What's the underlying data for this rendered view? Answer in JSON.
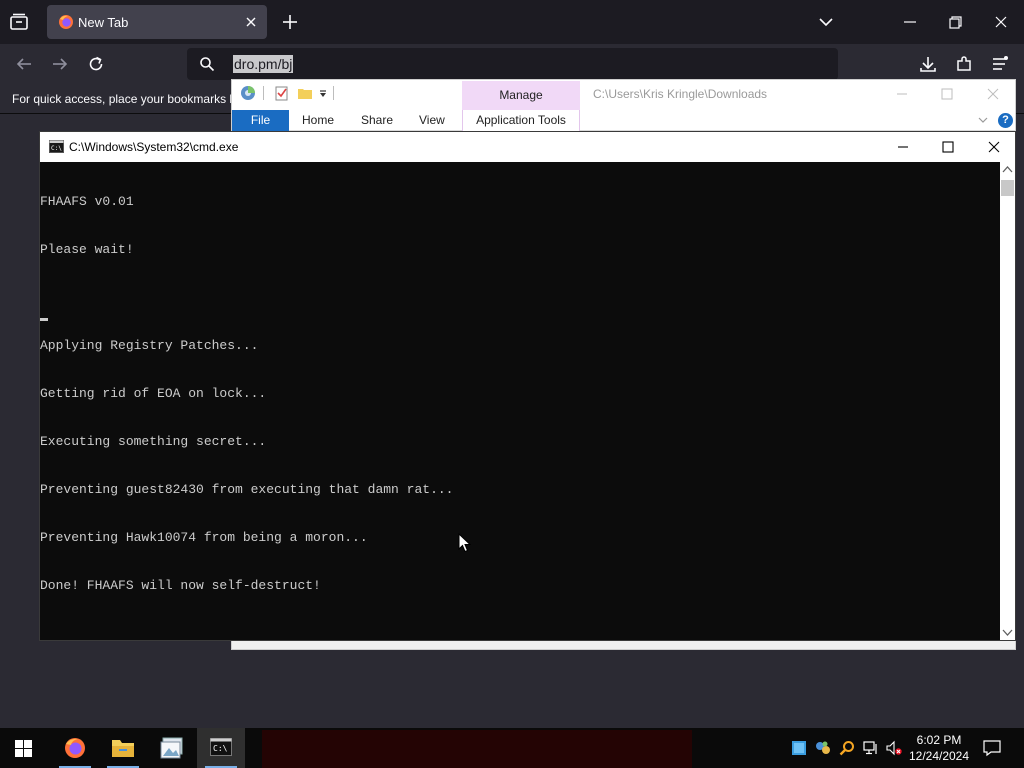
{
  "firefox": {
    "tab_title": "New Tab",
    "url_text": "dro.pm/bj",
    "bookmarks_msg": "For quick access, place your bookmarks h",
    "icons": [
      "tabs-list-icon",
      "firefox-icon",
      "close-icon",
      "plus-icon",
      "chevron-down-icon",
      "minimize-icon",
      "restore-icon",
      "close-icon",
      "back-icon",
      "forward-icon",
      "reload-icon",
      "search-icon",
      "download-icon",
      "extensions-icon",
      "hamburger-menu-icon"
    ]
  },
  "explorer": {
    "manage_label": "Manage",
    "path": "C:\\Users\\Kris Kringle\\Downloads",
    "tabs": {
      "file": "File",
      "home": "Home",
      "share": "Share",
      "view": "View",
      "app_tools": "Application Tools"
    },
    "help": "?"
  },
  "cmd": {
    "title": "C:\\Windows\\System32\\cmd.exe",
    "lines": [
      "FHAAFS v0.01",
      "Please wait!",
      "",
      "Applying Registry Patches...",
      "Getting rid of EOA on lock...",
      "Executing something secret...",
      "Preventing guest82430 from executing that damn rat...",
      "Preventing Hawk10074 from being a moron...",
      "Done! FHAAFS will now self-destruct!"
    ]
  },
  "taskbar": {
    "time": "6:02 PM",
    "date": "12/24/2024",
    "apps": [
      "start-icon",
      "firefox-icon",
      "file-explorer-icon",
      "photo-app-icon",
      "cmd-icon"
    ],
    "tray": [
      "app-tray-icon",
      "network-share-icon",
      "search-tray-icon",
      "network-icon",
      "volume-muted-icon",
      "notification-icon"
    ]
  },
  "colors": {
    "firefox_dark": "#1c1b22",
    "firefox_toolbar": "#2b2a33",
    "explorer_file_tab": "#1a6cc2",
    "manage_tab": "#f1d9f7",
    "console_bg": "#0c0c0c",
    "console_text": "#cccccc"
  }
}
